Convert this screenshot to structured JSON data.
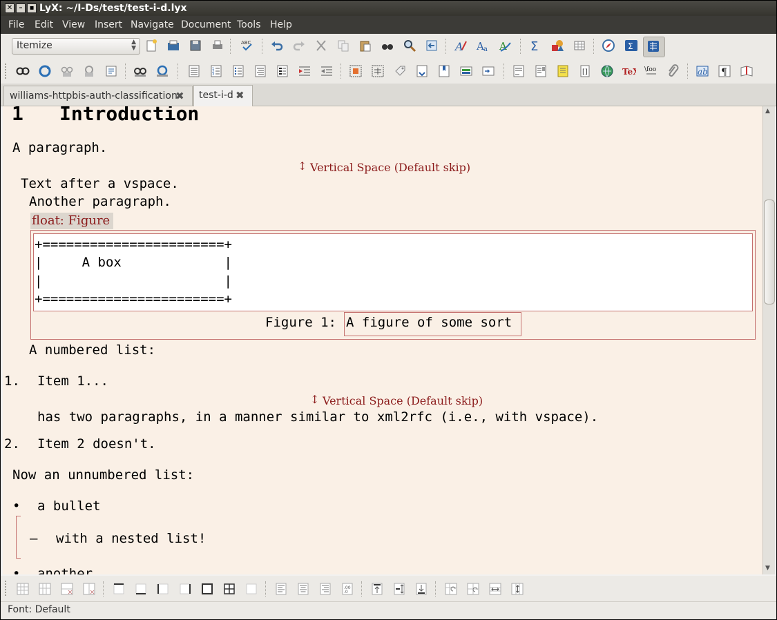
{
  "window": {
    "title": "LyX: ~/I-Ds/test/test-i-d.lyx",
    "title_buttons": [
      "close",
      "minimize",
      "maximize"
    ]
  },
  "menubar": {
    "items": [
      "File",
      "Edit",
      "View",
      "Insert",
      "Navigate",
      "Document",
      "Tools",
      "Help"
    ]
  },
  "toolbar": {
    "layout_combo_value": "Itemize"
  },
  "tabs": [
    {
      "label": "williams-httpbis-auth-classification",
      "active": false
    },
    {
      "label": "test-i-d",
      "active": true
    }
  ],
  "document": {
    "heading_number": "1",
    "heading_title": "Introduction",
    "para1": "A paragraph.",
    "vspace_label": "Vertical Space (Default skip)",
    "para2": "Text after a vspace.",
    "para3": "Another paragraph.",
    "float_label": "float: Figure",
    "figure_lines": [
      "+=======================+",
      "|     A box             |",
      "|                       |",
      "+=======================+"
    ],
    "caption_prefix": "Figure 1:",
    "caption_text": "A figure of some sort",
    "numbered_intro": "A numbered list:",
    "enum_items": [
      {
        "num": "1.",
        "text": "Item 1..."
      },
      {
        "num": "2.",
        "text": "Item 2 doesn't."
      }
    ],
    "item1_para2": "has two paragraphs, in a manner similar to xml2rfc (i.e., with vspace).",
    "unnumbered_intro": "Now an unnumbered list:",
    "bullet": "•",
    "dash": "–",
    "bullet1": "a bullet",
    "nested1": "with a nested list!",
    "bullet2": "another"
  },
  "statusbar": {
    "text": "Font: Default"
  },
  "colors": {
    "doc_background": "#faf0e6",
    "accent_red": "#8b1a1a",
    "menubar": "#3c3b37"
  }
}
